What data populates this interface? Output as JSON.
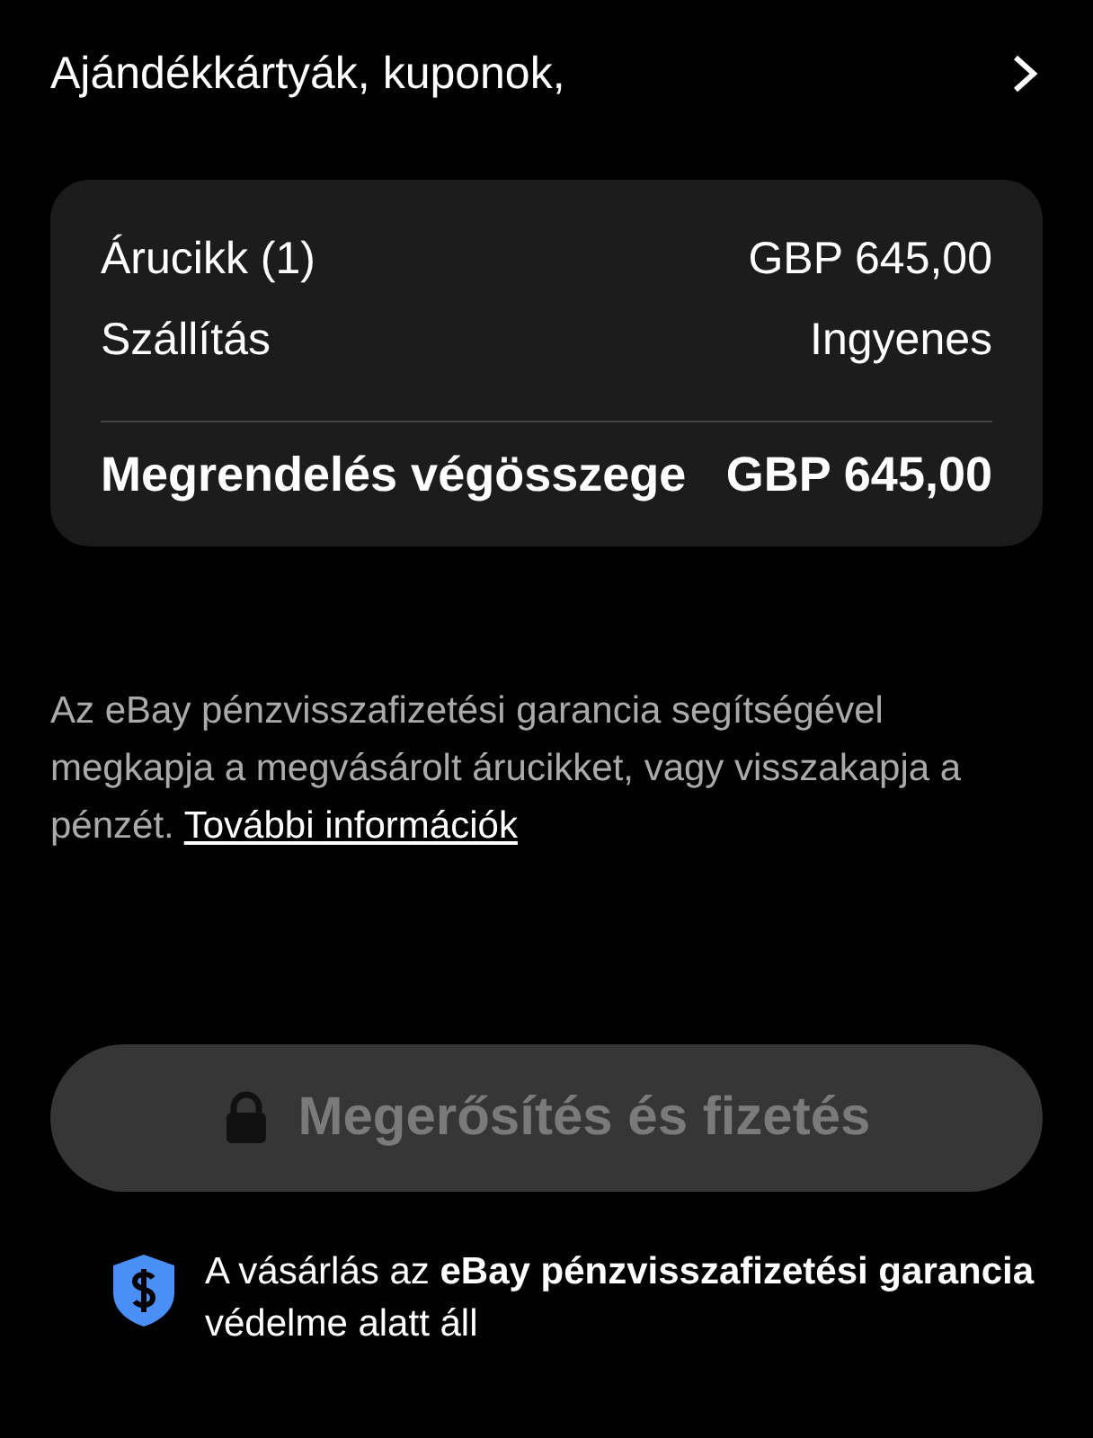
{
  "coupons_row": {
    "label": "Ajándékkártyák, kuponok,"
  },
  "summary": {
    "rows": [
      {
        "label": "Árucikk (1)",
        "value": "GBP 645,00"
      },
      {
        "label": "Szállítás",
        "value": "Ingyenes"
      }
    ],
    "total": {
      "label": "Megrendelés végösszege",
      "value": "GBP 645,00"
    }
  },
  "guarantee_note": {
    "text": "Az eBay pénzvisszafizetési garancia segítségével megkapja a megvásárolt árucikket, vagy visszakapja a pénzét.",
    "link": "További információk"
  },
  "confirm_button": {
    "label": "Megerősítés és fizetés",
    "disabled": true
  },
  "protection_note": {
    "text": "A vásárlás az **eBay pénzvisszafizetési garancia** védelme alatt áll"
  }
}
